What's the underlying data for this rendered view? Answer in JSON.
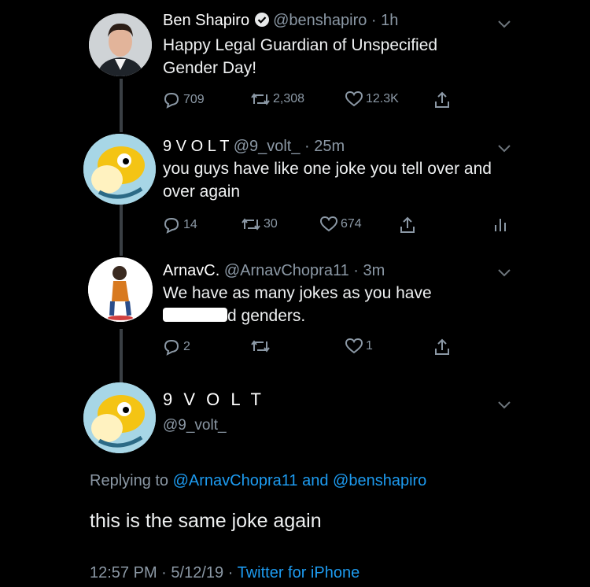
{
  "tweets": [
    {
      "name": "Ben Shapiro",
      "handle": "@benshapiro",
      "sep": "·",
      "time": "1h",
      "text": "Happy Legal Guardian of Unspecified Gender Day!",
      "replies": "709",
      "retweets": "2,308",
      "likes": "12.3K"
    },
    {
      "name": "9 V O L T",
      "handle": "@9_volt_",
      "sep": "·",
      "time": "25m",
      "text": "you guys have like one joke you tell over and over again",
      "replies": "14",
      "retweets": "30",
      "likes": "674"
    },
    {
      "name": "ArnavC.",
      "handle": "@ArnavChopra11",
      "sep": "·",
      "time": "3m",
      "text_line1": "We have as many jokes as you have",
      "text_line2_suffix": "d genders.",
      "replies": "2",
      "retweets": "",
      "likes": "1"
    }
  ],
  "focus": {
    "name": "9 V O L T",
    "handle": "@9_volt_",
    "replying_prefix": "Replying to",
    "replying_user1": "@ArnavChopra11",
    "replying_and": "and",
    "replying_user2": "@benshapiro",
    "text": "this is the same joke again",
    "time": "12:57 PM",
    "date": "5/12/19",
    "source": "Twitter for iPhone",
    "sep": "·"
  },
  "colors": {
    "link": "#1d9bf0",
    "muted": "#8b98a5",
    "thread": "#3a3f44"
  }
}
